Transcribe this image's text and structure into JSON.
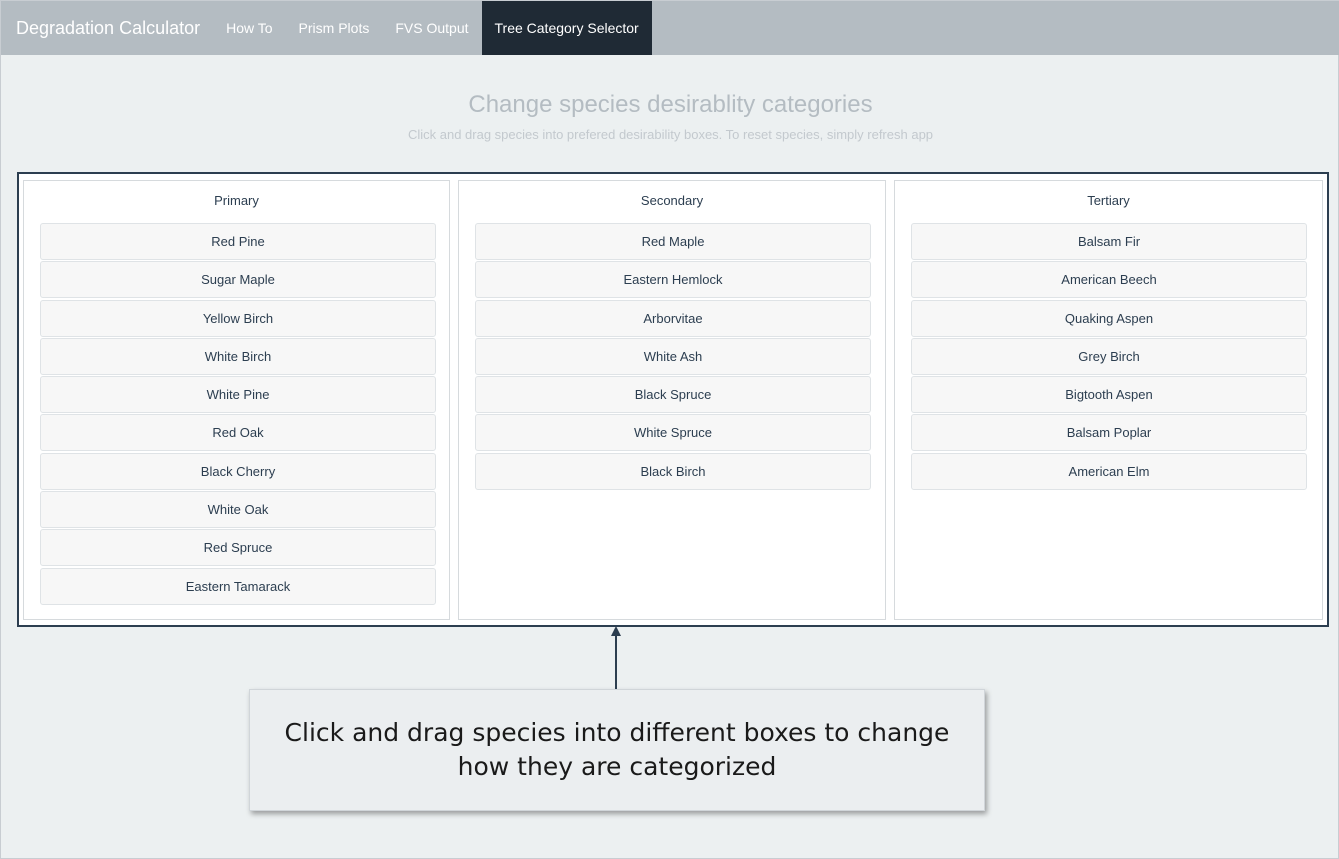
{
  "navbar": {
    "brand": "Degradation Calculator",
    "tabs": [
      {
        "label": "How To",
        "active": false
      },
      {
        "label": "Prism Plots",
        "active": false
      },
      {
        "label": "FVS Output",
        "active": false
      },
      {
        "label": "Tree Category Selector",
        "active": true
      }
    ]
  },
  "page": {
    "title": "Change species desirablity categories",
    "subtitle": "Click and drag species into prefered desirability boxes. To reset species, simply refresh app"
  },
  "columns": [
    {
      "title": "Primary",
      "items": [
        "Red Pine",
        "Sugar Maple",
        "Yellow Birch",
        "White Birch",
        "White Pine",
        "Red Oak",
        "Black Cherry",
        "White Oak",
        "Red Spruce",
        "Eastern Tamarack"
      ]
    },
    {
      "title": "Secondary",
      "items": [
        "Red Maple",
        "Eastern Hemlock",
        "Arborvitae",
        "White Ash",
        "Black Spruce",
        "White Spruce",
        "Black Birch"
      ]
    },
    {
      "title": "Tertiary",
      "items": [
        "Balsam Fir",
        "American Beech",
        "Quaking Aspen",
        "Grey Birch",
        "Bigtooth Aspen",
        "Balsam Poplar",
        "American Elm"
      ]
    }
  ],
  "callout": {
    "text": "Click and drag species into different boxes to change how they are categorized"
  },
  "colors": {
    "navbar": "#b4bcc2",
    "active_tab": "#1f2a35",
    "board_border": "#2c3e50"
  }
}
